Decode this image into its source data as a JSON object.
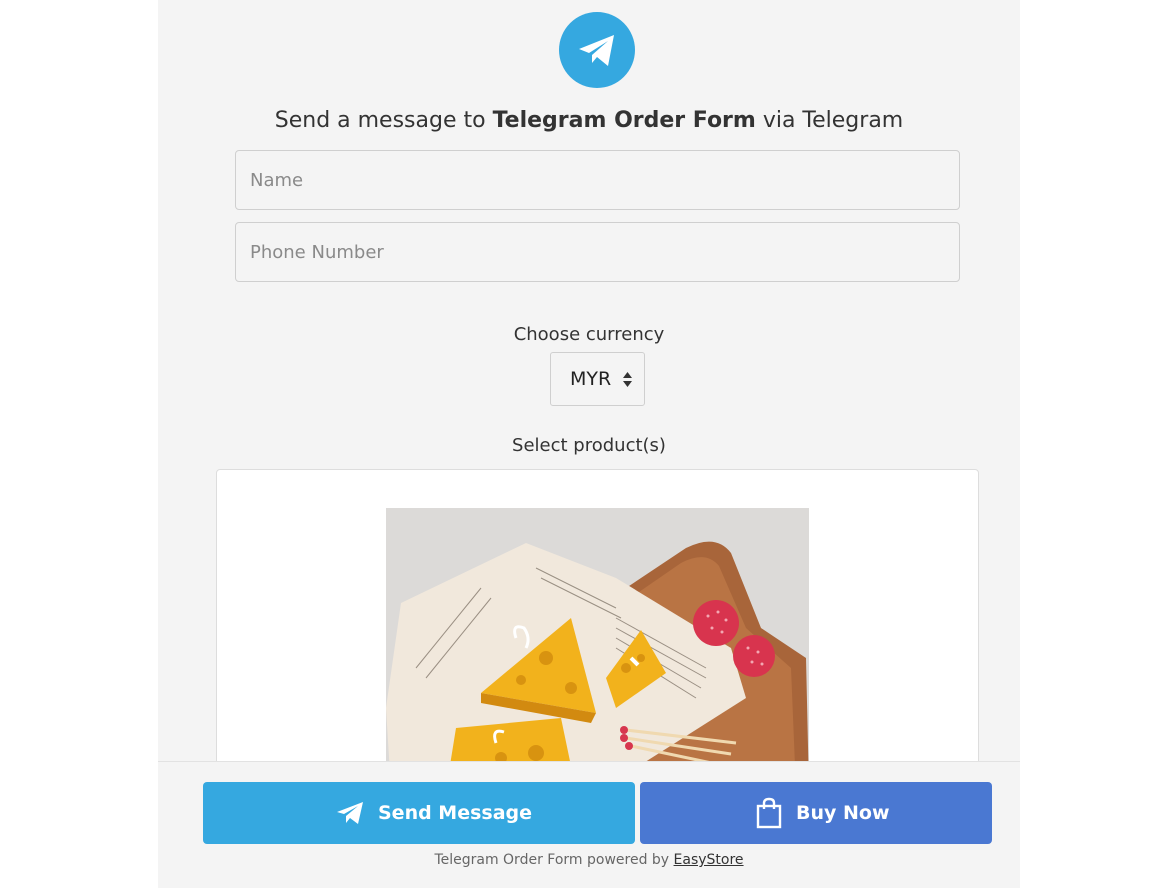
{
  "header": {
    "title_prefix": "Send a message to ",
    "title_store": "Telegram Order Form",
    "title_suffix": " via Telegram",
    "logo_icon": "telegram-plane-icon"
  },
  "form": {
    "name_placeholder": "Name",
    "phone_placeholder": "Phone Number",
    "currency_label": "Choose currency",
    "currency_value": "MYR",
    "products_label": "Select product(s)"
  },
  "buttons": {
    "send_label": "Send Message",
    "send_icon": "telegram-plane-icon",
    "buy_label": "Buy Now",
    "buy_icon": "shopping-bag-icon"
  },
  "footer": {
    "powered_text": "Telegram Order Form powered by ",
    "powered_link": "EasyStore"
  },
  "colors": {
    "telegram_blue": "#35a8e0",
    "buy_blue": "#4a78d2",
    "panel_bg": "#f4f4f4"
  }
}
